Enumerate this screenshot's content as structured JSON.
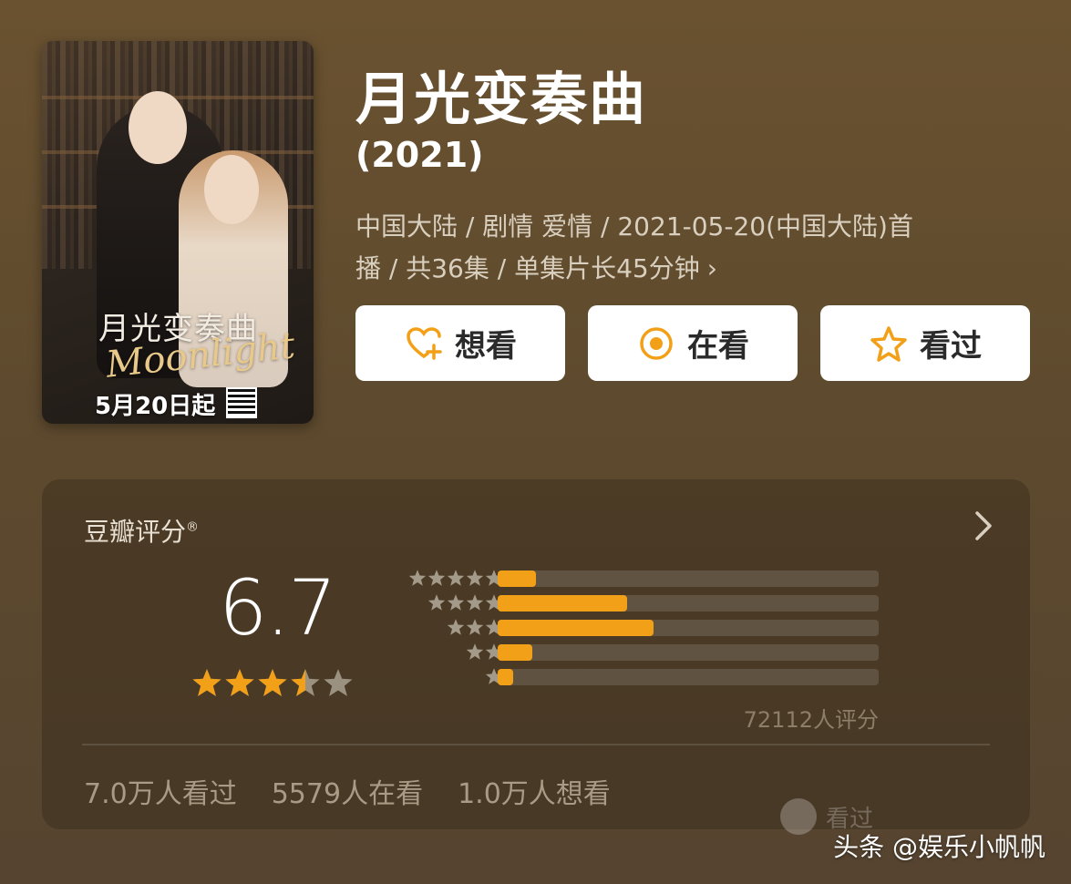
{
  "show": {
    "title": "月光变奏曲",
    "year": "(2021)",
    "meta_line1": "中国大陆 / 剧情 爱情 / 2021-05-20(中国大陆)首",
    "meta_line2": "播 / 共36集 / 单集片长45分钟",
    "meta_chevron": "›"
  },
  "poster": {
    "title_text": "月光变奏曲",
    "subtitle_text": "Moonlight",
    "date_text": "5月20日起"
  },
  "actions": [
    {
      "label": "想看",
      "icon": "heart-plus-icon"
    },
    {
      "label": "在看",
      "icon": "target-circle-icon"
    },
    {
      "label": "看过",
      "icon": "star-outline-icon"
    }
  ],
  "rating": {
    "title": "豆瓣评分",
    "registered_mark": "®",
    "score": "6.7",
    "stars_out_of_5": 3.5,
    "distribution": [
      {
        "stars": 5,
        "fraction": 0.1
      },
      {
        "stars": 4,
        "fraction": 0.34
      },
      {
        "stars": 3,
        "fraction": 0.41
      },
      {
        "stars": 2,
        "fraction": 0.09
      },
      {
        "stars": 1,
        "fraction": 0.04
      }
    ],
    "total_raters": "72112人评分",
    "stats": {
      "watched": "7.0万人看过",
      "watching": "5579人在看",
      "want": "1.0万人想看"
    }
  },
  "ghost_label": "看过",
  "watermark": "头条 @娱乐小帆帆",
  "colors": {
    "accent": "#f3a019",
    "star_empty": "#9a9181",
    "background": "#604b2f"
  }
}
